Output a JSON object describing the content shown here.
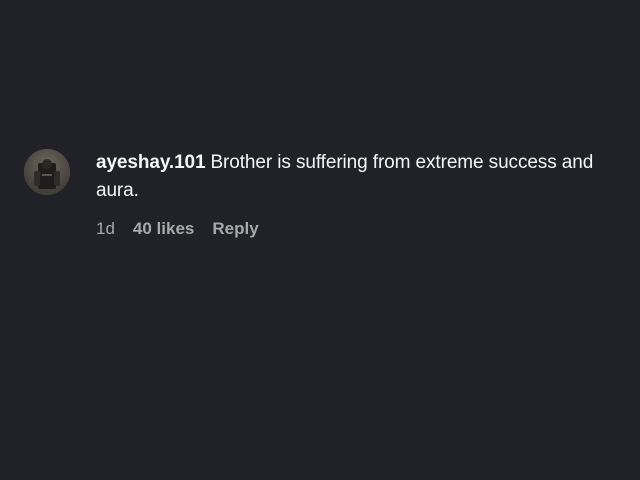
{
  "comment": {
    "username": "ayeshay.101",
    "text": "Brother is suffering from extreme success and aura.",
    "time": "1d",
    "likes": "40 likes",
    "reply_label": "Reply",
    "avatar_icon": "user-avatar-photo"
  },
  "colors": {
    "background": "#212227",
    "text": "#f5f5f5",
    "meta_text": "#a8a8a8"
  }
}
